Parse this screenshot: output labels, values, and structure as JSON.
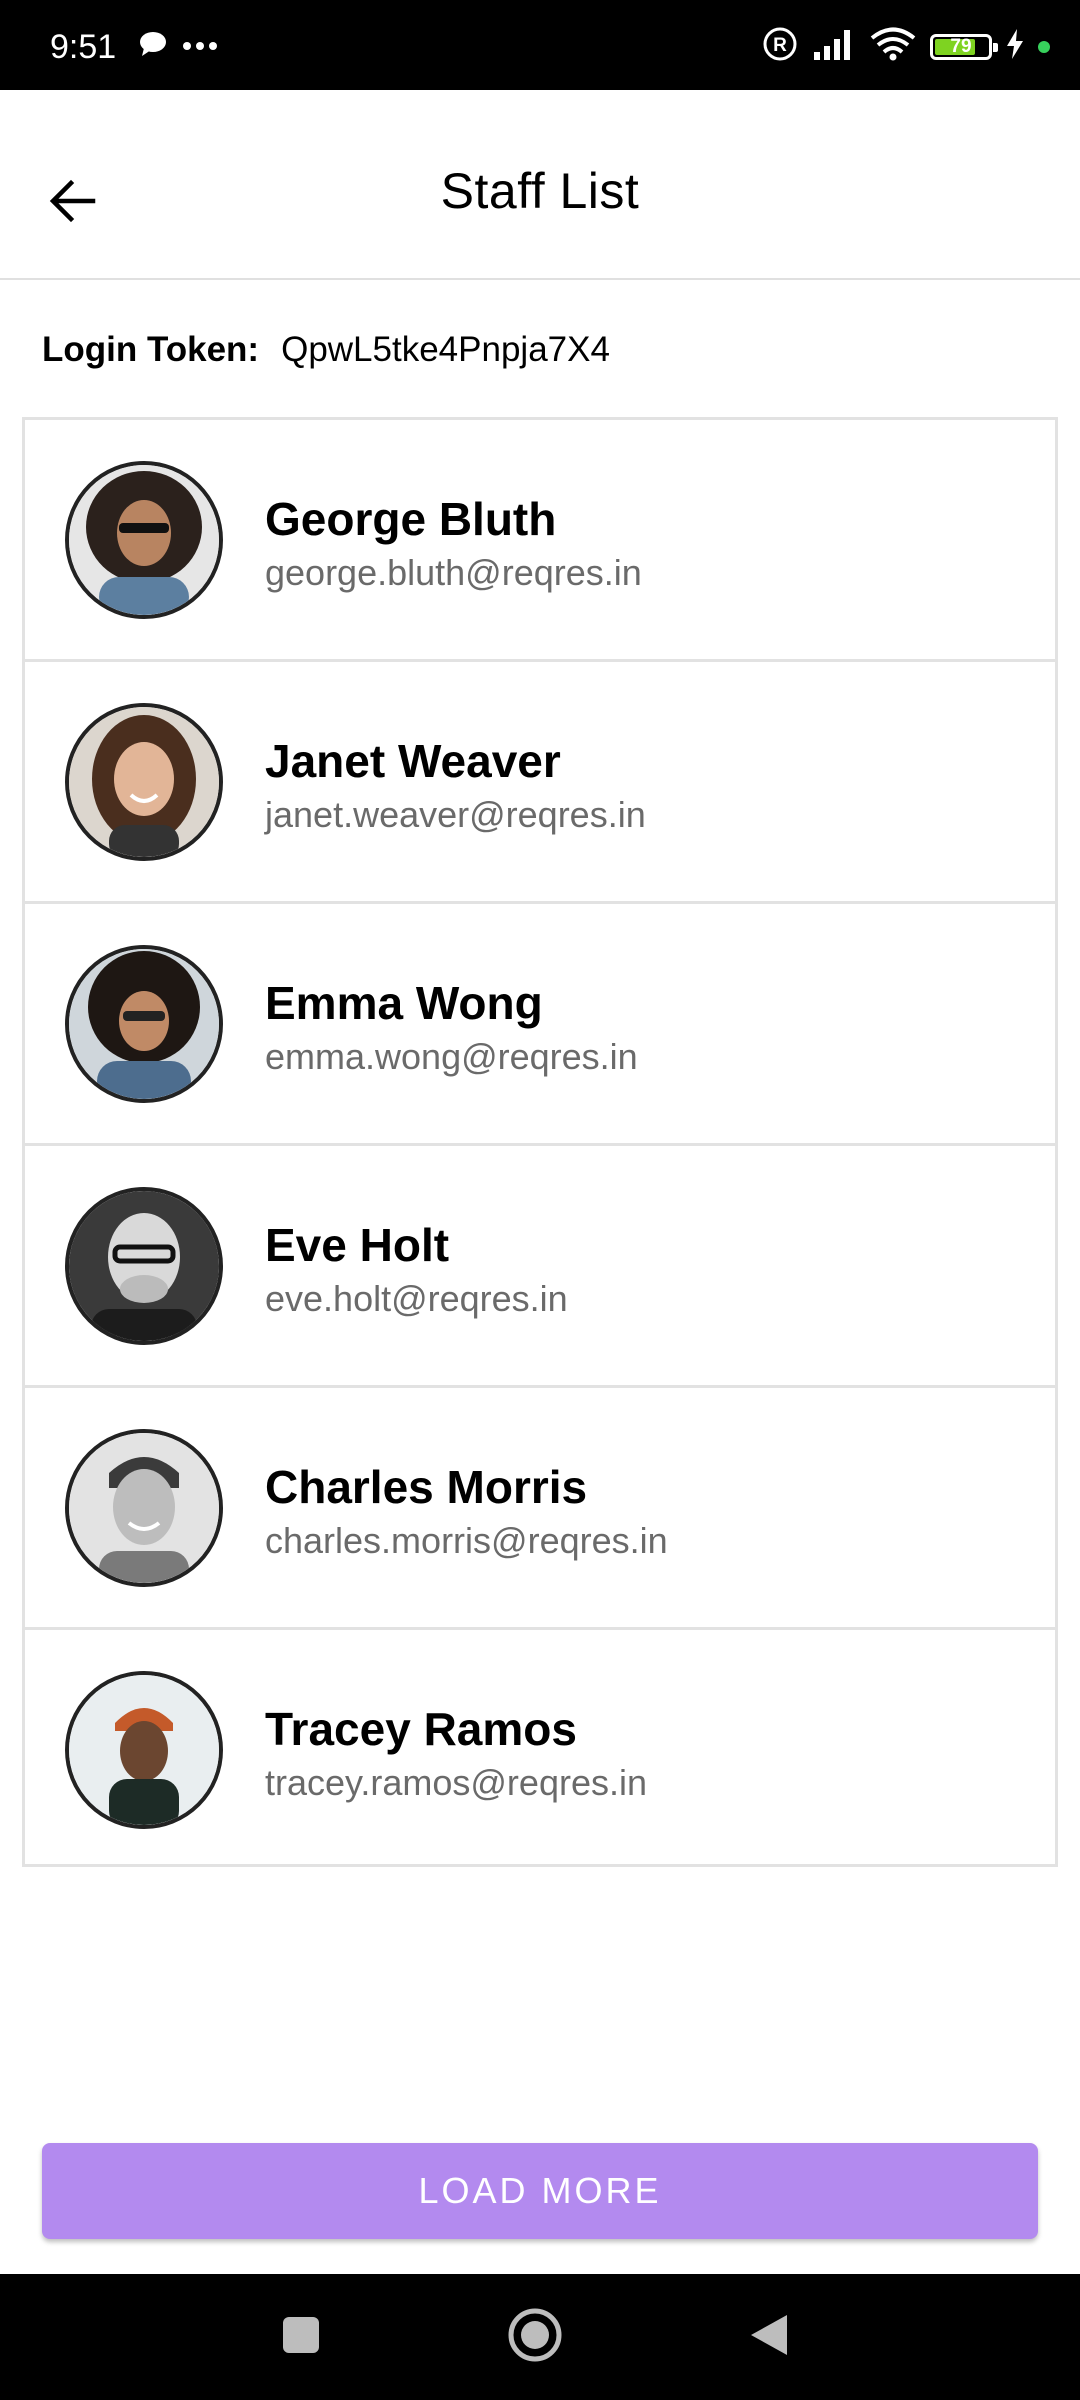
{
  "status_bar": {
    "time": "9:51",
    "battery_level": "79",
    "icons": [
      "chat-bubble-icon",
      "more-dots-icon",
      "registered-icon",
      "signal-icon",
      "wifi-icon",
      "battery-icon",
      "charging-icon",
      "green-dot-icon"
    ],
    "battery_fraction": 0.79
  },
  "header": {
    "title": "Staff List",
    "back_icon": "arrow-back-icon"
  },
  "token": {
    "label": "Login Token:",
    "value": "QpwL5tke4Pnpja7X4"
  },
  "staff": [
    {
      "name": "George Bluth",
      "email": "george.bluth@reqres.in"
    },
    {
      "name": "Janet Weaver",
      "email": "janet.weaver@reqres.in"
    },
    {
      "name": "Emma Wong",
      "email": "emma.wong@reqres.in"
    },
    {
      "name": "Eve Holt",
      "email": "eve.holt@reqres.in"
    },
    {
      "name": "Charles Morris",
      "email": "charles.morris@reqres.in"
    },
    {
      "name": "Tracey Ramos",
      "email": "tracey.ramos@reqres.in"
    }
  ],
  "load_more": {
    "label": "LOAD MORE"
  },
  "colors": {
    "accent": "#b38aef",
    "battery": "#7ed321",
    "divider": "#e2e2e2"
  }
}
